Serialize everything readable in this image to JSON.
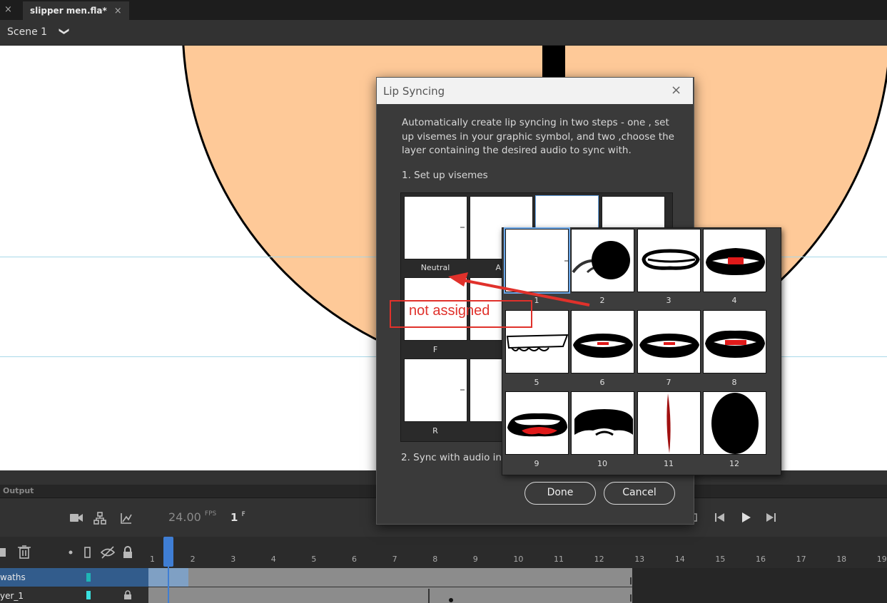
{
  "tabs": {
    "close_glyph": "×",
    "file_name": "slipper men.fla*",
    "file_close": "×"
  },
  "scene": {
    "label": "Scene 1",
    "chevron": "❯"
  },
  "dialog": {
    "title": "Lip Syncing",
    "close": "×",
    "description": "Automatically create lip syncing in two steps - one , set up visemes in your graphic symbol, and two ,choose the layer containing the desired audio to sync with.",
    "step1": "1. Set up visemes",
    "step2": "2. Sync with audio in la",
    "visemes": [
      {
        "label": "Neutral"
      },
      {
        "label": "A"
      },
      {
        "label": ""
      },
      {
        "label": ""
      },
      {
        "label": "F"
      },
      {
        "label": ""
      },
      {
        "label": "R"
      },
      {
        "label": ""
      }
    ],
    "done_label": "Done",
    "cancel_label": "Cancel"
  },
  "popup": {
    "frames": [
      "1",
      "2",
      "3",
      "4",
      "5",
      "6",
      "7",
      "8",
      "9",
      "10",
      "11",
      "12"
    ],
    "selected": "1"
  },
  "annotation": {
    "text": "not assigned",
    "color": "#e0312b"
  },
  "timeline": {
    "output_tab": "Output",
    "fps_value": "24.00",
    "fps_unit": "FPS",
    "current_frame": "1",
    "frame_unit": "F",
    "ruler_numbers": [
      "1",
      "2",
      "3",
      "4",
      "5",
      "6",
      "7",
      "8",
      "9",
      "10",
      "11",
      "12",
      "13",
      "14",
      "15",
      "16",
      "17",
      "18",
      "19"
    ],
    "layers": [
      {
        "name": "waths",
        "selected": true
      },
      {
        "name": "yer_1",
        "selected": false
      }
    ]
  },
  "colors": {
    "stage_circle": "#fec998",
    "playhead": "#3f7ed4",
    "selected_layer": "#325c8c"
  }
}
